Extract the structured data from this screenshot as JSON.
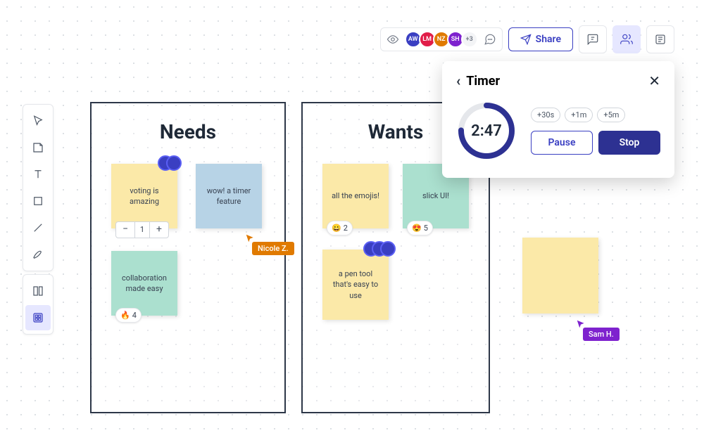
{
  "topbar": {
    "avatars": [
      {
        "initials": "AW",
        "bg": "#3a3fc2"
      },
      {
        "initials": "LM",
        "bg": "#e11d48"
      },
      {
        "initials": "NZ",
        "bg": "#e07a00"
      },
      {
        "initials": "SH",
        "bg": "#7e22ce"
      }
    ],
    "more_count": "+3",
    "share_label": "Share"
  },
  "boards": {
    "needs": {
      "title": "Needs",
      "stickies": {
        "voting": {
          "text": "voting is amazing",
          "stepper_value": "1"
        },
        "timer_feature": {
          "text": "wow! a timer feature"
        },
        "collab": {
          "text": "collaboration made easy",
          "reaction_emoji": "🔥",
          "reaction_count": "4"
        }
      }
    },
    "wants": {
      "title": "Wants",
      "stickies": {
        "emojis": {
          "text": "all the emojis!",
          "reaction_emoji": "😀",
          "reaction_count": "2"
        },
        "slick": {
          "text": "slick UI!",
          "reaction_emoji": "😍",
          "reaction_count": "5"
        },
        "pen": {
          "text": "a pen tool that's easy to use"
        }
      }
    }
  },
  "cursors": {
    "nicole": "Nicole Z.",
    "sam": "Sam H."
  },
  "timer": {
    "title": "Timer",
    "time": "2:47",
    "add_30s": "+30s",
    "add_1m": "+1m",
    "add_5m": "+5m",
    "pause": "Pause",
    "stop": "Stop"
  }
}
